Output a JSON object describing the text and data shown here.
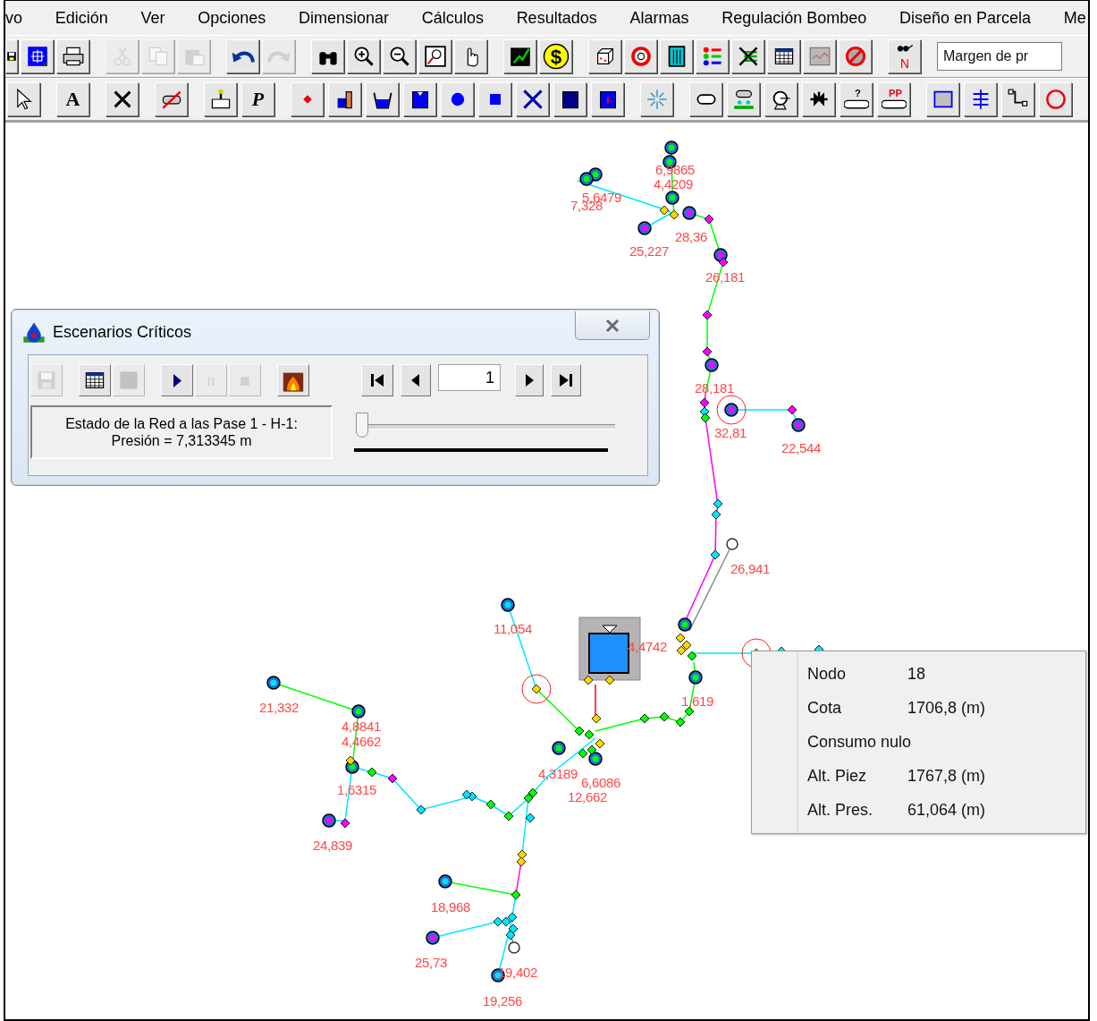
{
  "menu": [
    {
      "label": "vo"
    },
    {
      "label": "Edición"
    },
    {
      "label": "Ver"
    },
    {
      "label": "Opciones"
    },
    {
      "label": "Dimensionar"
    },
    {
      "label": "Cálculos"
    },
    {
      "label": "Resultados"
    },
    {
      "label": "Alarmas"
    },
    {
      "label": "Regulación Bombeo"
    },
    {
      "label": "Diseño en Parcela"
    },
    {
      "label": "Me"
    }
  ],
  "toolbars": [
    {
      "groups": [
        [
          {
            "kind": "save",
            "disabled": false
          },
          {
            "kind": "grid",
            "disabled": false
          },
          {
            "kind": "printer",
            "disabled": false
          }
        ],
        [
          {
            "kind": "cut",
            "disabled": true
          },
          {
            "kind": "copy",
            "disabled": true
          },
          {
            "kind": "paste",
            "disabled": true
          }
        ],
        [
          {
            "kind": "undo",
            "disabled": false
          },
          {
            "kind": "redo",
            "disabled": true
          }
        ],
        [
          {
            "kind": "binoculars",
            "disabled": false
          },
          {
            "kind": "zoomin",
            "disabled": false
          },
          {
            "kind": "zoomout",
            "disabled": false
          },
          {
            "kind": "extents",
            "disabled": false
          },
          {
            "kind": "hand",
            "disabled": false
          }
        ],
        [
          {
            "kind": "chartpen",
            "disabled": false
          },
          {
            "kind": "coin",
            "text": "$",
            "disabled": false
          }
        ],
        [
          {
            "kind": "cube",
            "disabled": false
          },
          {
            "kind": "stopsign",
            "disabled": false
          },
          {
            "kind": "calculator",
            "disabled": false
          },
          {
            "kind": "legend",
            "disabled": false
          },
          {
            "kind": "crossed",
            "disabled": false
          },
          {
            "kind": "table",
            "disabled": false
          },
          {
            "kind": "chartgrey",
            "disabled": false
          },
          {
            "kind": "noentry",
            "disabled": false
          }
        ],
        [
          {
            "kind": "north",
            "text": "N",
            "disabled": false
          }
        ]
      ],
      "combo": {
        "value": "Margen de pr"
      }
    },
    {
      "groups": [
        [
          {
            "kind": "pointer",
            "disabled": false
          }
        ],
        [
          {
            "kind": "letter",
            "text": "A",
            "disabled": false
          }
        ],
        [
          {
            "kind": "cross",
            "disabled": false
          }
        ],
        [
          {
            "kind": "pipecrossed",
            "disabled": false
          }
        ],
        [
          {
            "kind": "faucet",
            "disabled": false
          },
          {
            "kind": "letter",
            "text": "P",
            "disabled": false
          }
        ],
        [
          {
            "kind": "reddot",
            "disabled": false
          },
          {
            "kind": "building",
            "disabled": false
          },
          {
            "kind": "basin",
            "disabled": false
          },
          {
            "kind": "tank",
            "disabled": false
          },
          {
            "kind": "bluedot",
            "disabled": false
          },
          {
            "kind": "bluesquare",
            "disabled": false
          },
          {
            "kind": "bluecross",
            "disabled": false
          },
          {
            "kind": "darktank",
            "disabled": false
          },
          {
            "kind": "tankquery",
            "disabled": false
          }
        ],
        [
          {
            "kind": "sparkle",
            "disabled": false
          }
        ],
        [
          {
            "kind": "pipe",
            "disabled": false
          },
          {
            "kind": "pipegreen",
            "disabled": false
          },
          {
            "kind": "pump",
            "disabled": false
          },
          {
            "kind": "valve",
            "disabled": false
          },
          {
            "kind": "pipetext",
            "text": "?",
            "disabled": false
          },
          {
            "kind": "pipetext",
            "text": "PP",
            "disabled": false
          }
        ],
        [
          {
            "kind": "square",
            "disabled": false
          },
          {
            "kind": "comb",
            "disabled": false
          },
          {
            "kind": "step",
            "disabled": false
          },
          {
            "kind": "ring",
            "disabled": false
          }
        ]
      ]
    }
  ],
  "node_labels": [
    {
      "text": "6,9865"
    },
    {
      "text": "4,4209"
    },
    {
      "text": "7,328"
    },
    {
      "text": "5,6479"
    },
    {
      "text": "28,36"
    },
    {
      "text": "25,227"
    },
    {
      "text": "26,181"
    },
    {
      "text": "28,181"
    },
    {
      "text": "32,81"
    },
    {
      "text": "22,544"
    },
    {
      "text": "26,941"
    },
    {
      "text": "11,054"
    },
    {
      "text": "4,4742"
    },
    {
      "text": "1,619"
    },
    {
      "text": "21,332"
    },
    {
      "text": "4,8841"
    },
    {
      "text": "4,4662"
    },
    {
      "text": "1,6315"
    },
    {
      "text": "4,3189"
    },
    {
      "text": "6,6086"
    },
    {
      "text": "12,662"
    },
    {
      "text": "24,839"
    },
    {
      "text": "18,968"
    },
    {
      "text": "25,73"
    },
    {
      "text": "19,402"
    },
    {
      "text": "19,256"
    }
  ],
  "dialog": {
    "title": "Escenarios Críticos",
    "tools": [
      [
        {
          "kind": "save",
          "disabled": true
        }
      ],
      [
        {
          "kind": "table",
          "disabled": false
        },
        {
          "kind": "block",
          "disabled": true
        }
      ],
      [
        {
          "kind": "play",
          "disabled": false
        },
        {
          "kind": "pause",
          "disabled": true
        },
        {
          "kind": "stop",
          "disabled": true
        }
      ],
      [
        {
          "kind": "fire",
          "disabled": false
        }
      ]
    ],
    "step": "1",
    "status_lines": [
      "Estado de la Red a las Pase 1 - H-1:",
      "Presión = 7,313345 m"
    ],
    "slider": {
      "level": 0
    }
  },
  "tooltip": {
    "rows": [
      {
        "label": "Nodo",
        "value": "18"
      },
      {
        "label": "Cota",
        "value": "1706,8 (m)"
      },
      {
        "label": "Consumo nulo"
      },
      {
        "label": "Alt. Piez",
        "value": "1767,8 (m)"
      },
      {
        "label": "Alt. Pres.",
        "value": "61,064 (m)"
      }
    ]
  }
}
